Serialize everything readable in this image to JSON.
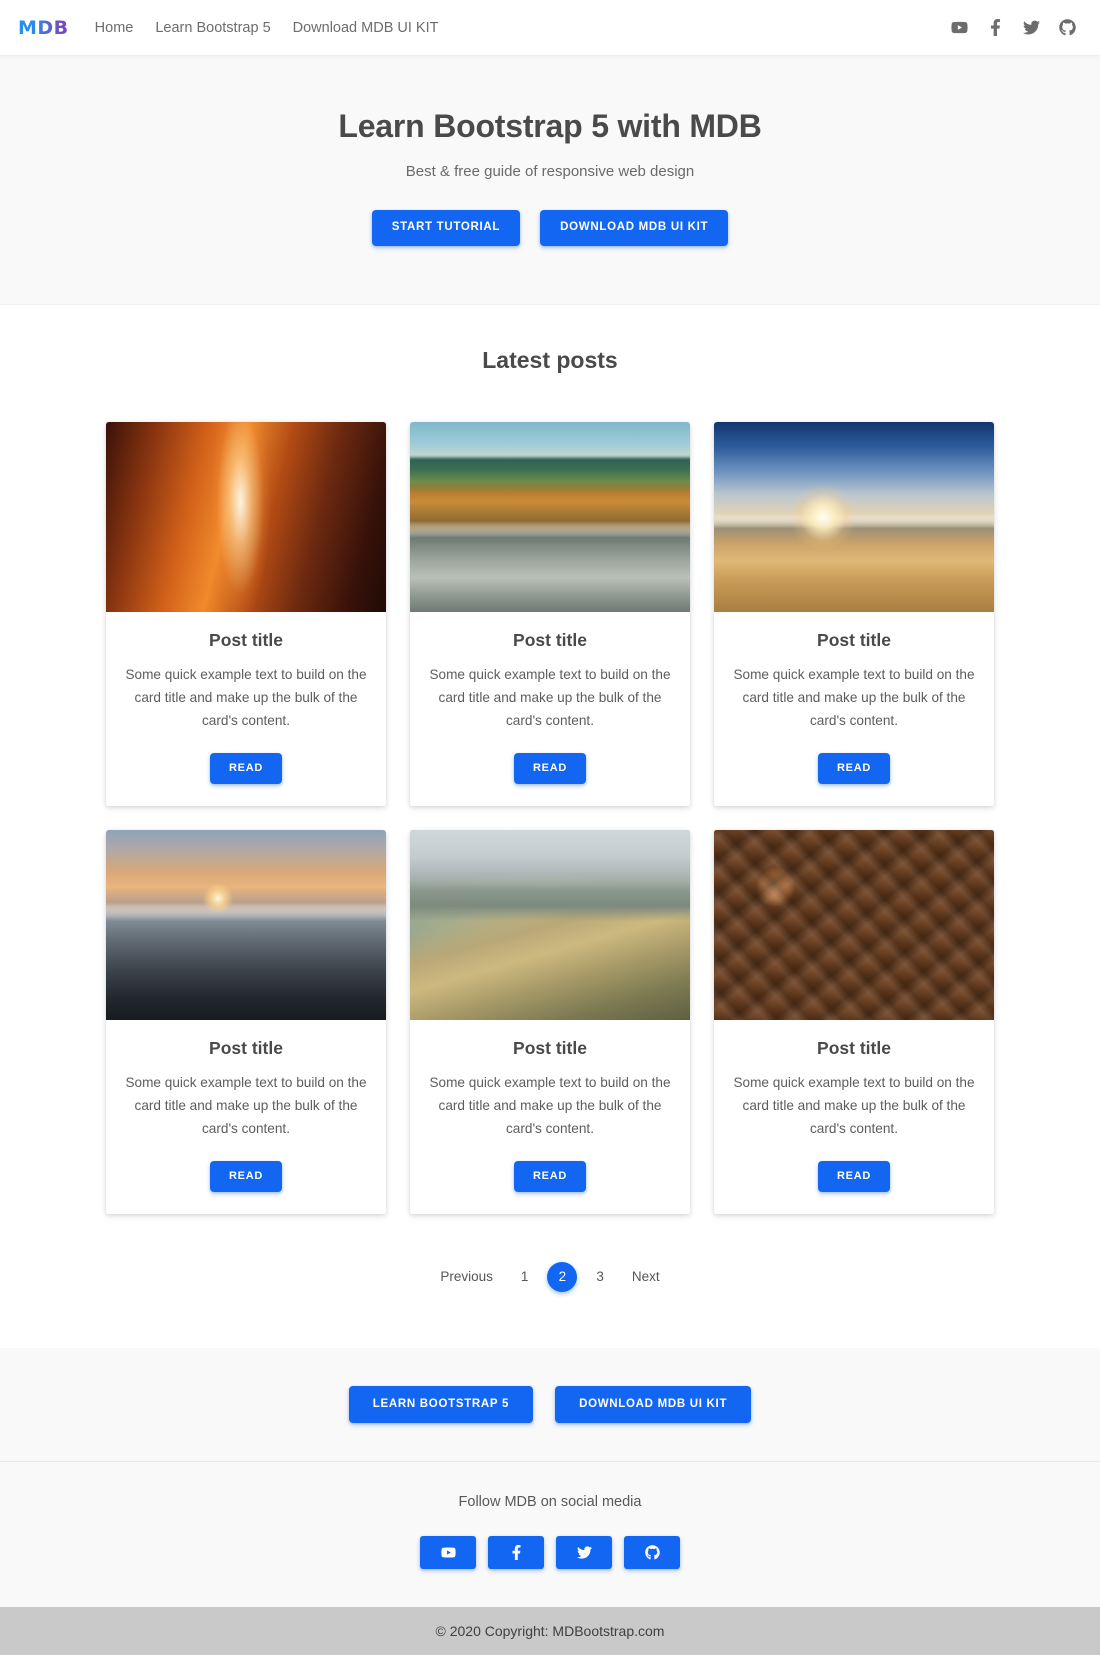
{
  "navbar": {
    "brand": "MDB",
    "links": [
      {
        "label": "Home",
        "name": "nav-link-home"
      },
      {
        "label": "Learn Bootstrap 5",
        "name": "nav-link-learn-bootstrap-5"
      },
      {
        "label": "Download MDB UI KIT",
        "name": "nav-link-download-mdb-ui-kit"
      }
    ],
    "social": [
      {
        "icon": "youtube-icon"
      },
      {
        "icon": "facebook-icon"
      },
      {
        "icon": "twitter-icon"
      },
      {
        "icon": "github-icon"
      }
    ]
  },
  "hero": {
    "title": "Learn Bootstrap 5 with MDB",
    "subtitle": "Best & free guide of responsive web design",
    "primary_button": "START TUTORIAL",
    "secondary_button": "DOWNLOAD MDB UI KIT"
  },
  "posts": {
    "section_title": "Latest posts",
    "read_button": "READ",
    "items": [
      {
        "title": "Post title",
        "text": "Some quick example text to build on the card title and make up the bulk of the card's content.",
        "image": "slot-canyon-photo"
      },
      {
        "title": "Post title",
        "text": "Some quick example text to build on the card title and make up the bulk of the card's content.",
        "image": "autumn-forest-river-photo"
      },
      {
        "title": "Post title",
        "text": "Some quick example text to build on the card title and make up the bulk of the card's content.",
        "image": "beach-sunset-photo"
      },
      {
        "title": "Post title",
        "text": "Some quick example text to build on the card title and make up the bulk of the card's content.",
        "image": "rocky-coast-sunset-photo"
      },
      {
        "title": "Post title",
        "text": "Some quick example text to build on the card title and make up the bulk of the card's content.",
        "image": "misty-hills-photo"
      },
      {
        "title": "Post title",
        "text": "Some quick example text to build on the card title and make up the bulk of the card's content.",
        "image": "stacked-firewood-photo"
      }
    ]
  },
  "pagination": {
    "previous": "Previous",
    "next": "Next",
    "pages": [
      "1",
      "2",
      "3"
    ],
    "active_page": "2"
  },
  "footer": {
    "learn_button": "LEARN BOOTSTRAP 5",
    "download_button": "DOWNLOAD MDB UI KIT",
    "social_text": "Follow MDB on social media",
    "social": [
      {
        "icon": "youtube-icon"
      },
      {
        "icon": "facebook-icon"
      },
      {
        "icon": "twitter-icon"
      },
      {
        "icon": "github-icon"
      }
    ],
    "copyright": "© 2020 Copyright: MDBootstrap.com"
  },
  "colors": {
    "primary": "#1266f1",
    "hero_bg": "#f9f9f9",
    "copyright_bg": "#c9c9c9",
    "text": "#4f4f4f"
  }
}
